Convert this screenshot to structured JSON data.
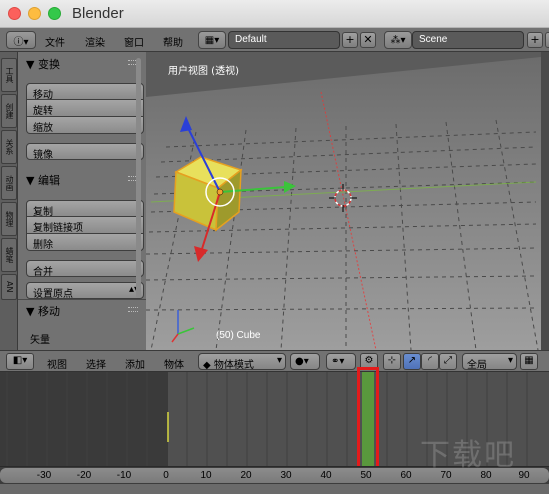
{
  "window": {
    "title": "Blender"
  },
  "topbar": {
    "info_icon": "info-icon",
    "menus": [
      "文件",
      "渲染",
      "窗口",
      "帮助"
    ],
    "layout_value": "Default",
    "scene_value": "Scene",
    "add_symbol": "+",
    "close_symbol": "✕"
  },
  "toolshelf": {
    "tabs": [
      "工具",
      "创建",
      "关系",
      "动画",
      "物理",
      "蜡笔",
      "AN"
    ]
  },
  "panel": {
    "transform": {
      "title": "变换",
      "buttons": [
        "移动",
        "旋转",
        "缩放"
      ],
      "mirror": "镜像"
    },
    "edit": {
      "title": "编辑",
      "buttons": [
        "复制",
        "复制链接项",
        "删除"
      ],
      "join": "合并",
      "origin": "设置原点"
    },
    "operator": {
      "title": "移动",
      "vector": "矢量"
    }
  },
  "viewport": {
    "view_label": "用户视图 (透视)",
    "status": "(50) Cube"
  },
  "header3d": {
    "menus": [
      "视图",
      "选择",
      "添加",
      "物体"
    ],
    "mode": "物体模式",
    "orientation": "全局"
  },
  "timeline": {
    "current_frame": 50,
    "ticks": [
      -30,
      -20,
      -10,
      0,
      10,
      20,
      30,
      40,
      50,
      60,
      70,
      80,
      90
    ]
  },
  "watermark": "下载吧",
  "colors": {
    "highlight": "#e31b1b",
    "playhead": "#5aa43a",
    "active_tool": "#5a7fc4"
  }
}
